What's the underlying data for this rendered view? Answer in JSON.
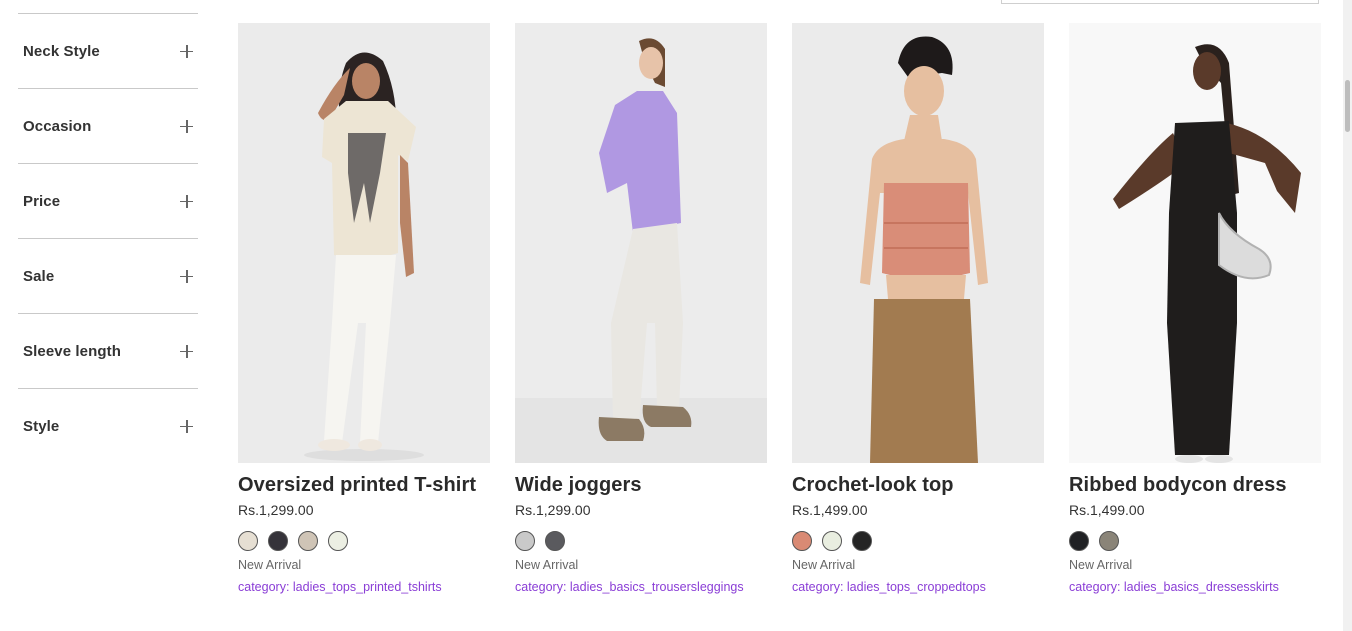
{
  "filters": [
    {
      "label": "Neck Style"
    },
    {
      "label": "Occasion"
    },
    {
      "label": "Price"
    },
    {
      "label": "Sale"
    },
    {
      "label": "Sleeve length"
    },
    {
      "label": "Style"
    }
  ],
  "products": [
    {
      "title": "Oversized printed T-shirt",
      "price": "Rs.1,299.00",
      "swatches": [
        "#e6dfd3",
        "#35333a",
        "#cfc4b6",
        "#ecefe3"
      ],
      "badge": "New Arrival",
      "category": "category: ladies_tops_printed_tshirts",
      "image_bg": "#ececec"
    },
    {
      "title": "Wide joggers",
      "price": "Rs.1,299.00",
      "swatches": [
        "#c9c9c9",
        "#5a5a5e"
      ],
      "badge": "New Arrival",
      "category": "category: ladies_basics_trousersleggings",
      "image_bg": "#ececec"
    },
    {
      "title": "Crochet-look top",
      "price": "Rs.1,499.00",
      "swatches": [
        "#d98a74",
        "#e9eee0",
        "#242424"
      ],
      "badge": "New Arrival",
      "category": "category: ladies_tops_croppedtops",
      "image_bg": "#ececec"
    },
    {
      "title": "Ribbed bodycon dress",
      "price": "Rs.1,499.00",
      "swatches": [
        "#202124",
        "#8a8478"
      ],
      "badge": "New Arrival",
      "category": "category: ladies_basics_dressesskirts",
      "image_bg": "#f7f7f7"
    }
  ]
}
